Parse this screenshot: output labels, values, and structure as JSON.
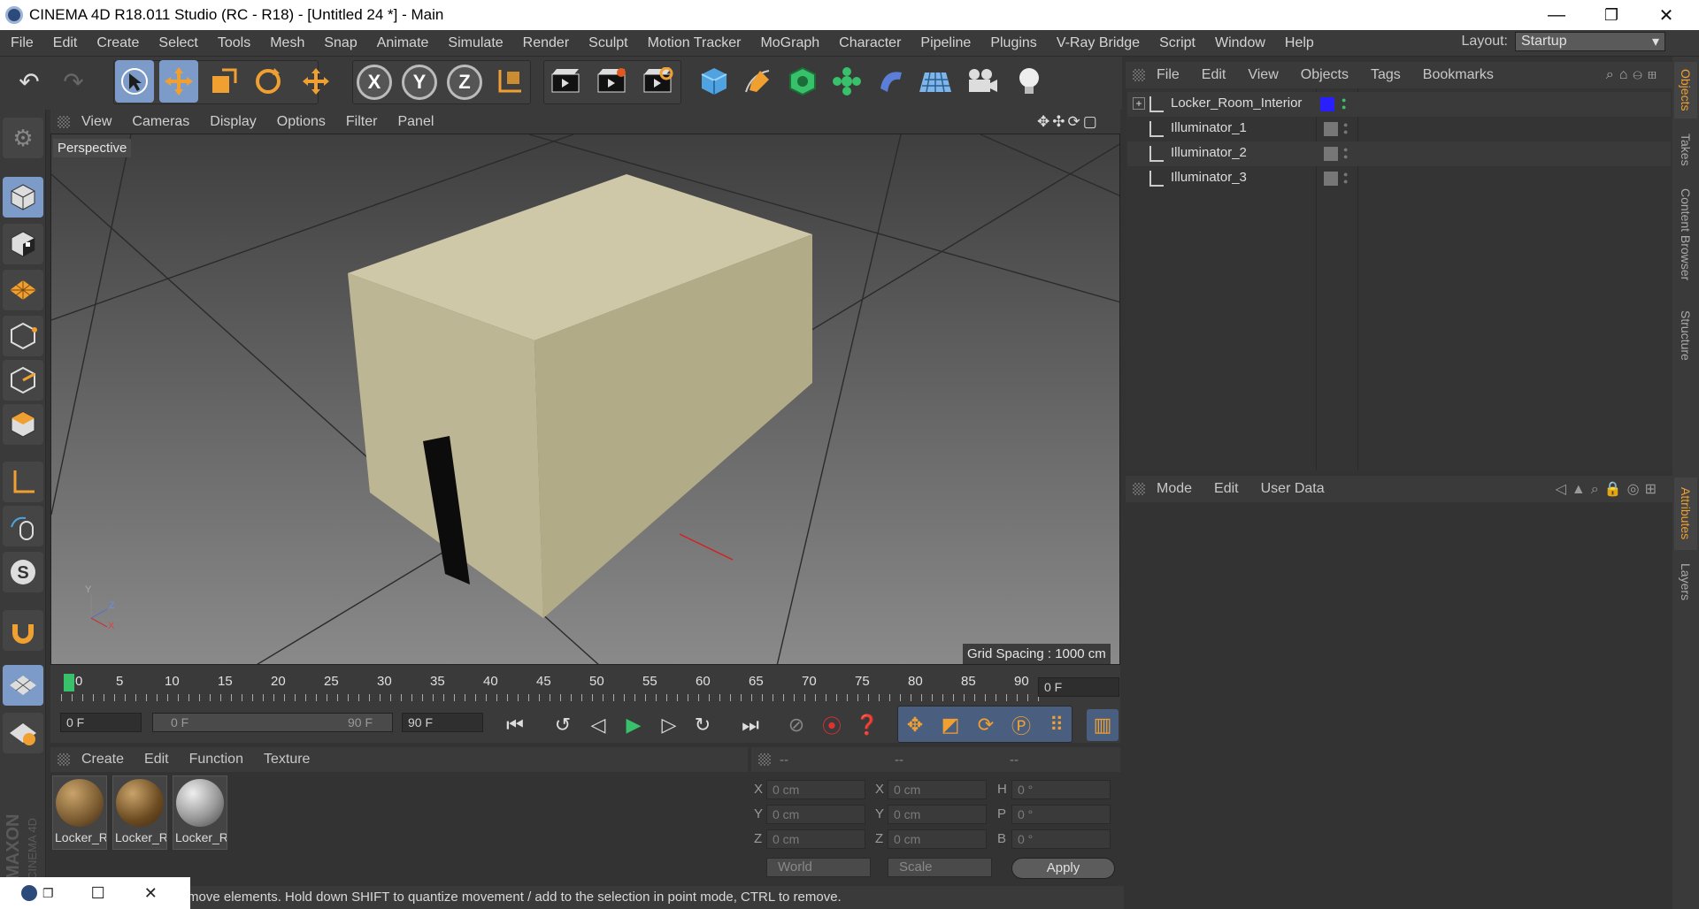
{
  "window": {
    "title": "CINEMA 4D R18.011 Studio (RC - R18) - [Untitled 24 *] - Main",
    "minimize": "—",
    "maximize": "❐",
    "close": "✕"
  },
  "menubar": {
    "items": [
      "File",
      "Edit",
      "Create",
      "Select",
      "Tools",
      "Mesh",
      "Snap",
      "Animate",
      "Simulate",
      "Render",
      "Sculpt",
      "Motion Tracker",
      "MoGraph",
      "Character",
      "Pipeline",
      "Plugins",
      "V-Ray Bridge",
      "Script",
      "Window",
      "Help"
    ],
    "layout_label": "Layout:",
    "layout_value": "Startup"
  },
  "toolbar": {
    "axis_x": "X",
    "axis_y": "Y",
    "axis_z": "Z"
  },
  "viewport": {
    "menu": [
      "View",
      "Cameras",
      "Display",
      "Options",
      "Filter",
      "Panel"
    ],
    "camera_label": "Perspective",
    "grid_spacing": "Grid Spacing : 1000 cm",
    "axis_y": "Y",
    "axis_z": "Z",
    "axis_x": "X",
    "accent": "#ff0000"
  },
  "timeline": {
    "ticks": [
      "0",
      "5",
      "10",
      "15",
      "20",
      "25",
      "30",
      "35",
      "40",
      "45",
      "50",
      "55",
      "60",
      "65",
      "70",
      "75",
      "80",
      "85",
      "90"
    ],
    "current_frame": "0 F",
    "start_field": "0 F",
    "range_start": "0 F",
    "range_end": "90 F",
    "end_field": "90 F"
  },
  "materials": {
    "menu": [
      "Create",
      "Edit",
      "Function",
      "Texture"
    ],
    "items": [
      "Locker_R",
      "Locker_R",
      "Locker_R"
    ]
  },
  "coordinates": {
    "header": [
      "--",
      "--",
      "--"
    ],
    "rows": [
      {
        "l1": "X",
        "v1": "0 cm",
        "l2": "X",
        "v2": "0 cm",
        "l3": "H",
        "v3": "0 °"
      },
      {
        "l1": "Y",
        "v1": "0 cm",
        "l2": "Y",
        "v2": "0 cm",
        "l3": "P",
        "v3": "0 °"
      },
      {
        "l1": "Z",
        "v1": "0 cm",
        "l2": "Z",
        "v2": "0 cm",
        "l3": "B",
        "v3": "0 °"
      }
    ],
    "mode_world": "World",
    "mode_scale": "Scale",
    "apply": "Apply"
  },
  "objects": {
    "menu": [
      "File",
      "Edit",
      "View",
      "Objects",
      "Tags",
      "Bookmarks"
    ],
    "items": [
      {
        "name": "Locker_Room_Interior",
        "tag_color": "#2a1fff"
      },
      {
        "name": "Illuminator_1"
      },
      {
        "name": "Illuminator_2"
      },
      {
        "name": "Illuminator_3"
      }
    ]
  },
  "attributes": {
    "menu": [
      "Mode",
      "Edit",
      "User Data"
    ]
  },
  "right_tabs": [
    "Objects",
    "Takes",
    "Content Browser",
    "Structure",
    "Attributes",
    "Layers"
  ],
  "status": {
    "text": "move elements. Hold down SHIFT to quantize movement / add to the selection in point mode, CTRL to remove."
  },
  "branding": {
    "maxon": "MAXON",
    "cinema": "CINEMA 4D"
  }
}
